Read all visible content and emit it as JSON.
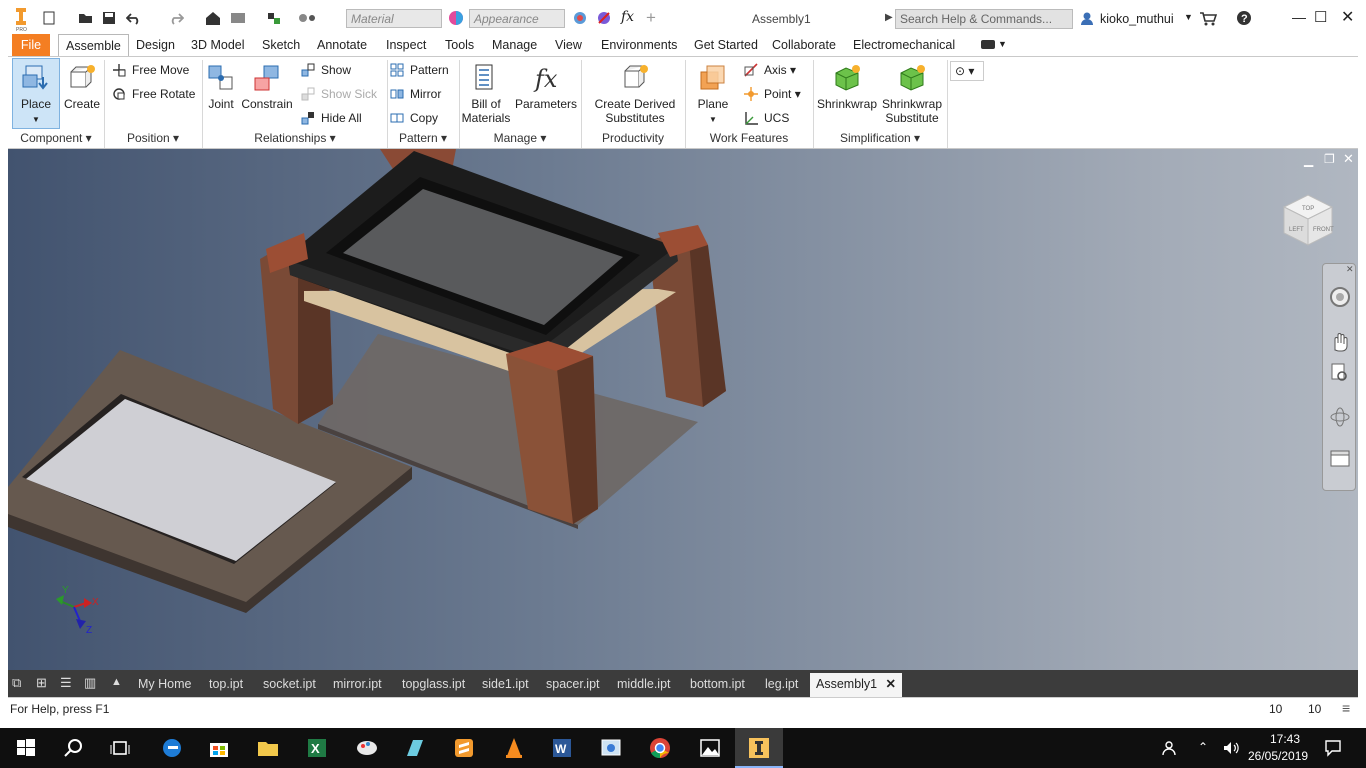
{
  "titlebar": {
    "material_placeholder": "Material",
    "appearance_placeholder": "Appearance",
    "title": "Assembly1",
    "search_placeholder": "Search Help & Commands...",
    "user": "kioko_muthui"
  },
  "tabs": [
    "File",
    "Assemble",
    "Design",
    "3D Model",
    "Sketch",
    "Annotate",
    "Inspect",
    "Tools",
    "Manage",
    "View",
    "Environments",
    "Get Started",
    "Collaborate",
    "Electromechanical"
  ],
  "ribbon": {
    "place": "Place",
    "create": "Create",
    "free_move": "Free Move",
    "free_rotate": "Free Rotate",
    "joint": "Joint",
    "constrain": "Constrain",
    "show": "Show",
    "show_sick": "Show Sick",
    "hide_all": "Hide All",
    "pattern": "Pattern",
    "mirror": "Mirror",
    "copy": "Copy",
    "bill_of_materials_1": "Bill of",
    "bill_of_materials_2": "Materials",
    "parameters": "Parameters",
    "create_derived_1": "Create Derived",
    "create_derived_2": "Substitutes",
    "plane": "Plane",
    "axis": "Axis",
    "point": "Point",
    "ucs": "UCS",
    "shrinkwrap": "Shrinkwrap",
    "shrinkwrap_sub_1": "Shrinkwrap",
    "shrinkwrap_sub_2": "Substitute",
    "groups": {
      "component": "Component",
      "position": "Position",
      "relationships": "Relationships",
      "pattern": "Pattern",
      "manage": "Manage",
      "productivity": "Productivity",
      "work_features": "Work Features",
      "simplification": "Simplification"
    }
  },
  "viewcube": {
    "top": "TOP",
    "left": "LEFT",
    "front": "FRONT"
  },
  "triad": {
    "x": "X",
    "y": "Y",
    "z": "Z"
  },
  "filetabs": [
    "My Home",
    "top.ipt",
    "socket.ipt",
    "mirror.ipt",
    "topglass.ipt",
    "side1.ipt",
    "spacer.ipt",
    "middle.ipt",
    "bottom.ipt",
    "leg.ipt",
    "Assembly1"
  ],
  "status": {
    "help": "For Help, press F1",
    "count1": "10",
    "count2": "10"
  },
  "taskbar": {
    "time": "17:43",
    "date": "26/05/2019"
  },
  "colors": {
    "file_tab": "#f47e22",
    "accent": "#2b6cb0"
  }
}
